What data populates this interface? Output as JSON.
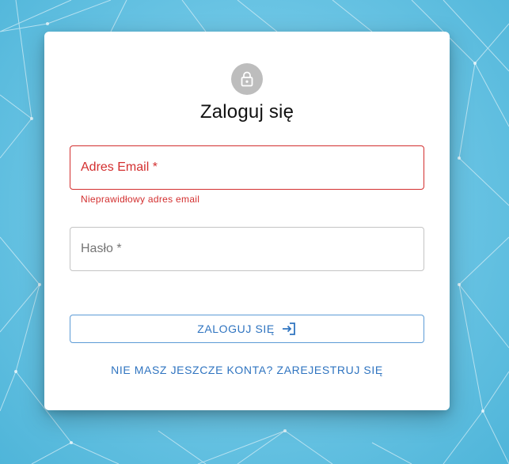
{
  "background": {
    "colors": {
      "base": "#6fc7e6",
      "lines": "#ffffff"
    }
  },
  "login_card": {
    "avatar_icon": "lock-icon",
    "title": "Zaloguj się",
    "email_field": {
      "label": "Adres Email *",
      "value": "",
      "error": true,
      "helper_text": "Nieprawidłowy adres email"
    },
    "password_field": {
      "label": "Hasło *",
      "value": ""
    },
    "submit_button": {
      "label": "ZALOGUJ SIĘ",
      "icon": "login-icon"
    },
    "register_link": "NIE MASZ JESZCZE KONTA? ZAREJESTRUJ SIĘ"
  },
  "colors": {
    "error": "#d32f2f",
    "primary": "#2f74c0",
    "avatar_bg": "#bdbdbd"
  }
}
